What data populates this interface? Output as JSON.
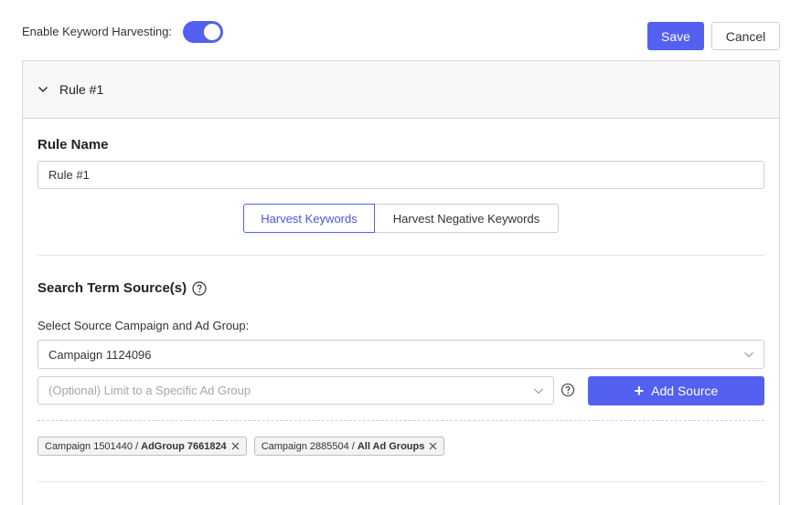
{
  "header": {
    "enable_label": "Enable Keyword Harvesting:",
    "toggle_on": true,
    "save_label": "Save",
    "cancel_label": "Cancel"
  },
  "rule": {
    "title": "Rule #1",
    "name_label": "Rule Name",
    "name_value": "Rule #1"
  },
  "mode_tabs": {
    "harvest": "Harvest Keywords",
    "harvest_negative": "Harvest Negative Keywords",
    "active": "harvest"
  },
  "sources": {
    "title": "Search Term Source(s)",
    "select_label": "Select Source Campaign and Ad Group:",
    "campaign_value": "Campaign 1124096",
    "adgroup_placeholder": "(Optional) Limit to a Specific Ad Group",
    "add_button": "Add Source",
    "chips": [
      {
        "campaign": "Campaign 1501440 /",
        "group": "AdGroup 7661824"
      },
      {
        "campaign": "Campaign 2885504 /",
        "group": "All Ad Groups"
      }
    ]
  },
  "colors": {
    "accent": "#5460f0",
    "border": "#cfcfcf"
  }
}
